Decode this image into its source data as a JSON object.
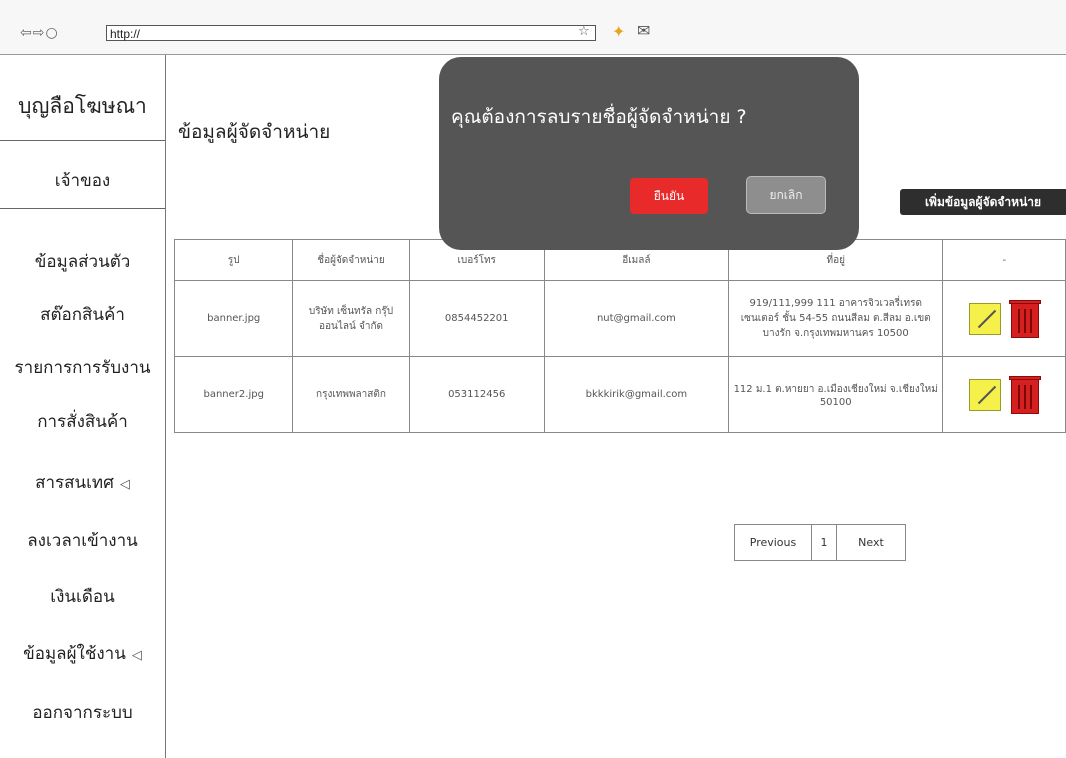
{
  "browser": {
    "nav": "⇦⇨○",
    "url": "http://",
    "star": "☆",
    "ext": "✦",
    "mail": "✉"
  },
  "sidebar": {
    "brand": "บุญลือโฆษณา",
    "owner": "เจ้าของ",
    "items": [
      {
        "label": "ข้อมูลส่วนตัว"
      },
      {
        "label": "สต๊อกสินค้า"
      },
      {
        "label": "รายการการรับงาน"
      },
      {
        "label": "การสั่งสินค้า"
      },
      {
        "label": "สารสนเทศ",
        "arrow": "◁"
      },
      {
        "label": "ลงเวลาเข้างาน"
      },
      {
        "label": "เงินเดือน"
      },
      {
        "label": "ข้อมูลผู้ใช้งาน",
        "arrow": "◁"
      },
      {
        "label": "ออกจากระบบ"
      }
    ]
  },
  "main": {
    "title": "ข้อมูลผู้จัดจำหน่าย",
    "add_button": "เพิ่มข้อมูลผู้จัดจำหน่าย"
  },
  "table": {
    "headers": [
      "รูป",
      "ชื่อผู้จัดจำหน่าย",
      "เบอร์โทร",
      "อีเมลล์",
      "ที่อยู่",
      "-"
    ],
    "rows": [
      {
        "image": "banner.jpg",
        "name": "บริษัท เซ็นทรัล กรุ๊ป ออนไลน์ จำกัด",
        "phone": "0854452201",
        "email": "nut@gmail.com",
        "address": "919/111,999 111 อาคารจิวเวลรี่เทรด เซนเตอร์ ชั้น 54-55 ถนนสีลม ต.สีลม อ.เขตบางรัก จ.กรุงเทพมหานคร 10500"
      },
      {
        "image": "banner2.jpg",
        "name": "กรุงเทพพลาสติก",
        "phone": "053112456",
        "email": "bkkkirik@gmail.com",
        "address": "112 ม.1 ต.หายยา อ.เมืองเชียงใหม่ จ.เชียงใหม่ 50100"
      }
    ]
  },
  "pagination": {
    "prev": "Previous",
    "page": "1",
    "next": "Next"
  },
  "modal": {
    "question": "คุณต้องการลบรายชื่อผู้จัดจำหน่าย ?",
    "confirm": "ยืนยัน",
    "cancel": "ยกเลิก"
  }
}
